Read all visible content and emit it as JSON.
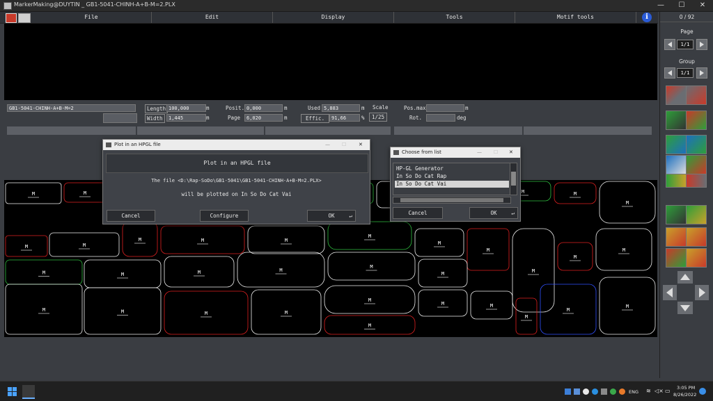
{
  "window": {
    "title": "MarkerMaking@DUYTIN _ GB1-5041-CHINH-A+B-M=2.PLX",
    "minimize": "—",
    "maximize": "☐",
    "close": "✕"
  },
  "menu": [
    "File",
    "Edit",
    "Display",
    "Tools",
    "Motif tools"
  ],
  "counter": "0 / 92",
  "info_fields": {
    "marker_name": "GB1-5041-CHINH-A+B-M=2",
    "length_label": "Length",
    "length_value": "100,000",
    "length_unit": "m",
    "width_label": "Width",
    "width_value": "1,445",
    "width_unit": "m",
    "posit_label": "Posit.",
    "posit_value": "0,000",
    "posit_unit": "m",
    "page_label": "Page",
    "page_value": "6,020",
    "page_unit": "m",
    "used_label": "Used",
    "used_value": "5,883",
    "used_unit": "m",
    "effic_label": "Effic.",
    "effic_value": "91,66",
    "effic_unit": "%",
    "scale_label": "Scale",
    "scale_value": "1/25",
    "posmax_label": "Pos.max",
    "posmax_unit": "m",
    "rot_label": "Rot.",
    "rot_unit": "deg"
  },
  "right_panel": {
    "page_label": "Page",
    "page_value": "1/1",
    "group_label": "Group",
    "group_value": "1/1"
  },
  "plot_dialog": {
    "title": "Plot in an HPGL file",
    "heading": "Plot in an HPGL file",
    "line1": "The file <D:\\Rap-SoDo\\GB1-5041\\GB1-5041-CHINH-A+B-M=2.PLX>",
    "line2": "will be plotted on In So Do Cat Vai",
    "cancel": "Cancel",
    "configure": "Configure",
    "ok": "OK"
  },
  "choose_dialog": {
    "title": "Choose from list",
    "items": [
      "HP-GL Generator",
      "In So Do Cat Rap",
      "In So Do Cat Vai"
    ],
    "selected_index": 2,
    "cancel": "Cancel",
    "ok": "OK"
  },
  "piece_label": "M",
  "taskbar": {
    "lang": "ENG",
    "time": "3:05 PM",
    "date": "8/26/2022"
  },
  "colors": {
    "accent_blue": "#1e6fd9",
    "piece_red": "#e02020",
    "piece_white": "#f0f0f0",
    "piece_green": "#2fbf3f",
    "piece_blue": "#3050ff"
  }
}
